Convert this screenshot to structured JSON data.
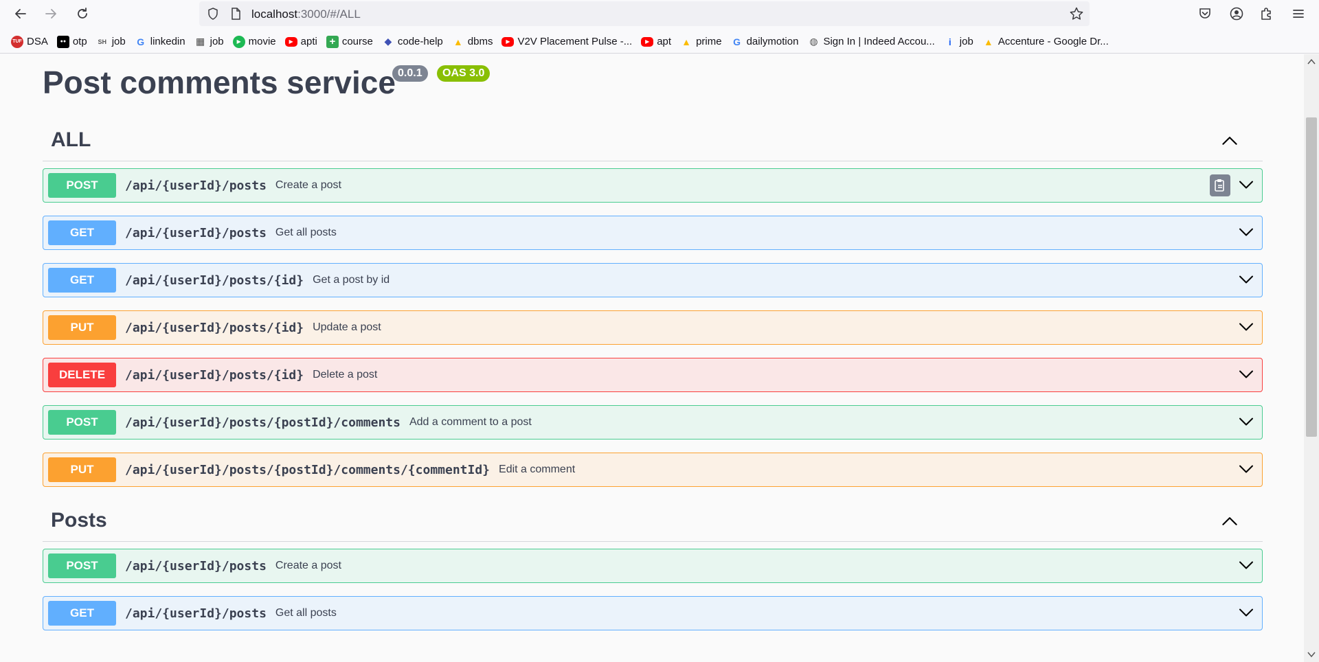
{
  "browser": {
    "url_host": "localhost",
    "url_rest": ":3000/#/ALL",
    "bookmarks": [
      {
        "label": "DSA",
        "icon": "tuf-icon",
        "color": "#d32f2f"
      },
      {
        "label": "otp",
        "icon": "medium-icon",
        "color": "#000000"
      },
      {
        "label": "job",
        "icon": "sh-icon",
        "color": "#555555"
      },
      {
        "label": "linkedin",
        "icon": "google-icon",
        "color": "#4285f4"
      },
      {
        "label": "job",
        "icon": "naukri-icon",
        "color": "#444444"
      },
      {
        "label": "movie",
        "icon": "play-icon",
        "color": "#1db954"
      },
      {
        "label": "apti",
        "icon": "youtube-icon",
        "color": "#ff0000"
      },
      {
        "label": "course",
        "icon": "plus-icon",
        "color": "#34a853"
      },
      {
        "label": "code-help",
        "icon": "code-icon",
        "color": "#3f51b5"
      },
      {
        "label": "dbms",
        "icon": "drive-icon",
        "color": "#fbbc04"
      },
      {
        "label": "V2V Placement Pulse -...",
        "icon": "youtube-icon",
        "color": "#ff0000"
      },
      {
        "label": "apt",
        "icon": "youtube-icon",
        "color": "#ff0000"
      },
      {
        "label": "prime",
        "icon": "drive-icon",
        "color": "#fbbc04"
      },
      {
        "label": "dailymotion",
        "icon": "google-icon",
        "color": "#4285f4"
      },
      {
        "label": "Sign In | Indeed Accou...",
        "icon": "globe-icon",
        "color": "#555555"
      },
      {
        "label": "job",
        "icon": "indeed-icon",
        "color": "#2164f3"
      },
      {
        "label": "Accenture - Google Dr...",
        "icon": "drive-icon",
        "color": "#fbbc04"
      }
    ]
  },
  "page": {
    "title": "Post comments service",
    "version_badge": "0.0.1",
    "oas_badge": "OAS 3.0"
  },
  "sections": [
    {
      "title": "ALL",
      "operations": [
        {
          "method": "POST",
          "path": "/api/{userId}/posts",
          "summary": "Create a post"
        },
        {
          "method": "GET",
          "path": "/api/{userId}/posts",
          "summary": "Get all posts"
        },
        {
          "method": "GET",
          "path": "/api/{userId}/posts/{id}",
          "summary": "Get a post by id"
        },
        {
          "method": "PUT",
          "path": "/api/{userId}/posts/{id}",
          "summary": "Update a post"
        },
        {
          "method": "DELETE",
          "path": "/api/{userId}/posts/{id}",
          "summary": "Delete a post"
        },
        {
          "method": "POST",
          "path": "/api/{userId}/posts/{postId}/comments",
          "summary": "Add a comment to a post"
        },
        {
          "method": "PUT",
          "path": "/api/{userId}/posts/{postId}/comments/{commentId}",
          "summary": "Edit a comment"
        }
      ]
    },
    {
      "title": "Posts",
      "operations": [
        {
          "method": "POST",
          "path": "/api/{userId}/posts",
          "summary": "Create a post"
        },
        {
          "method": "GET",
          "path": "/api/{userId}/posts",
          "summary": "Get all posts"
        }
      ]
    }
  ],
  "colors": {
    "post": "#49cc90",
    "get": "#61affe",
    "put": "#fca130",
    "delete": "#f93e3e",
    "oas_badge": "#89bf04",
    "version_badge": "#7d8492"
  }
}
